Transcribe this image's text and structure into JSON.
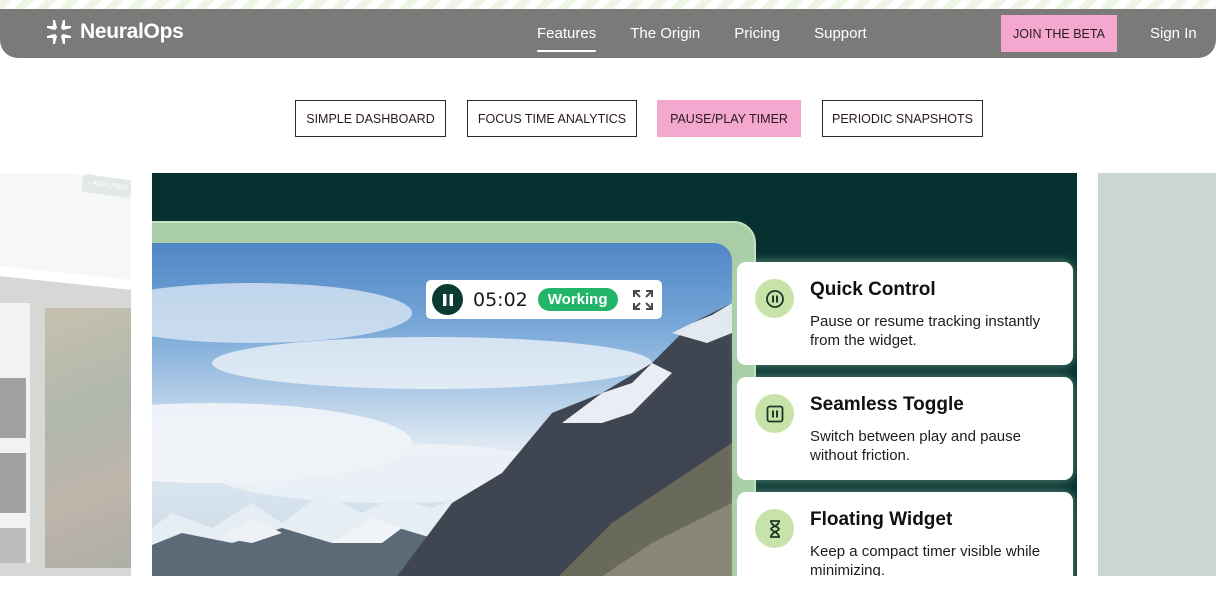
{
  "nav": {
    "brand": "NeuralOps",
    "links": [
      "Features",
      "The Origin",
      "Pricing",
      "Support"
    ],
    "active_link": "Features",
    "join_label": "JOIN THE BETA",
    "signin_label": "Sign In"
  },
  "tabs": {
    "items": [
      "SIMPLE DASHBOARD",
      "FOCUS TIME ANALYTICS",
      "PAUSE/PLAY TIMER",
      "PERIODIC SNAPSHOTS"
    ],
    "active": "PAUSE/PLAY TIMER"
  },
  "ghost": {
    "add_user": "+ ADD USER"
  },
  "timer": {
    "time": "05:02",
    "status": "Working"
  },
  "features": [
    {
      "icon": "pause-circle-icon",
      "title": "Quick Control",
      "desc": "Pause or resume tracking instantly from the widget."
    },
    {
      "icon": "pause-square-icon",
      "title": "Seamless Toggle",
      "desc": "Switch between play and pause without friction."
    },
    {
      "icon": "hourglass-icon",
      "title": "Floating Widget",
      "desc": "Keep a compact timer visible while minimizing."
    }
  ],
  "colors": {
    "nav_bg": "#7a7a78",
    "accent_pink": "#f4a7cf",
    "panel_dark": "#063130",
    "status_green": "#22b56a",
    "icon_bg": "#c8e3aa"
  }
}
